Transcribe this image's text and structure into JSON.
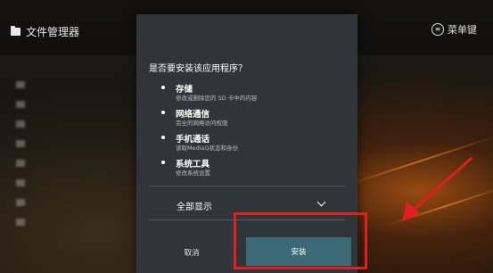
{
  "app": {
    "title": "文件管理器",
    "menu_key_label": "菜单键",
    "menu_key_icon": "menu-key-icon"
  },
  "dialog": {
    "title": "是否要安装该应用程序？",
    "permissions": [
      {
        "name": "存储",
        "desc": "修改或删除您的 SD 卡中的内容"
      },
      {
        "name": "网络通信",
        "desc": "完全的网络访问权限"
      },
      {
        "name": "手机通话",
        "desc": "读取MediaQ状态和身份"
      },
      {
        "name": "系统工具",
        "desc": "修改系统设置"
      }
    ],
    "show_all_label": "全部显示",
    "cancel_label": "取消",
    "install_label": "安装"
  },
  "colors": {
    "highlight": "#e02020",
    "arrow": "#e02020",
    "install_button": "#3d6a77",
    "dialog_bg": "#2f3538"
  }
}
